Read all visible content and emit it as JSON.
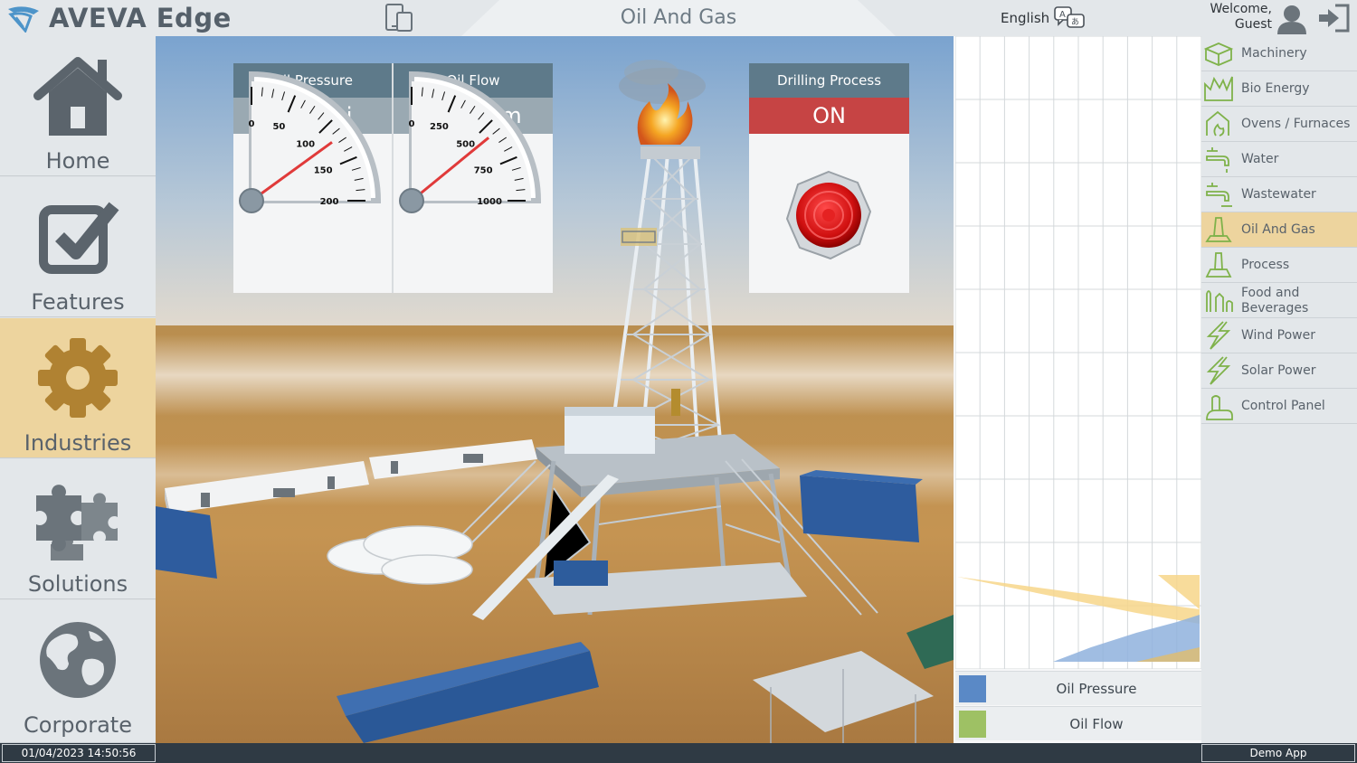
{
  "header": {
    "brand": "AVEVA Edge",
    "page_title": "Oil And Gas",
    "language": "English",
    "welcome": "Welcome,",
    "user": "Guest"
  },
  "left_nav": {
    "items": [
      {
        "label": "Home",
        "icon": "home-icon"
      },
      {
        "label": "Features",
        "icon": "checkbox-icon"
      },
      {
        "label": "Industries",
        "icon": "gear-icon",
        "active": true
      },
      {
        "label": "Solutions",
        "icon": "puzzle-icon"
      },
      {
        "label": "Corporate",
        "icon": "globe-icon"
      }
    ]
  },
  "gauges": {
    "oil_pressure": {
      "title": "Oil Pressure",
      "value_text": "120 psi",
      "value": 120,
      "ticks": [
        "0",
        "50",
        "100",
        "150",
        "200"
      ],
      "max": 200
    },
    "oil_flow": {
      "title": "Oil Flow",
      "value_text": "563 gpm",
      "value": 563,
      "ticks": [
        "0",
        "250",
        "500",
        "750",
        "1000"
      ],
      "max": 1000
    }
  },
  "drilling": {
    "title": "Drilling Process",
    "status": "ON"
  },
  "chart_legend": [
    {
      "label": "Oil Pressure",
      "color": "#5a89c6"
    },
    {
      "label": "Oil Flow",
      "color": "#9ec164"
    }
  ],
  "right_nav": {
    "items": [
      {
        "label": "Machinery",
        "icon": "machinery-icon"
      },
      {
        "label": "Bio Energy",
        "icon": "bio-energy-icon"
      },
      {
        "label": "Ovens / Furnaces",
        "icon": "furnace-icon"
      },
      {
        "label": "Water",
        "icon": "faucet-icon"
      },
      {
        "label": "Wastewater",
        "icon": "wastewater-icon"
      },
      {
        "label": "Oil And Gas",
        "icon": "oil-rig-icon",
        "active": true
      },
      {
        "label": "Process",
        "icon": "process-icon"
      },
      {
        "label": "Food and Beverages",
        "icon": "food-icon"
      },
      {
        "label": "Wind Power",
        "icon": "wind-power-icon"
      },
      {
        "label": "Solar Power",
        "icon": "solar-power-icon"
      },
      {
        "label": "Control Panel",
        "icon": "control-panel-icon"
      }
    ]
  },
  "footer": {
    "datetime": "01/04/2023 14:50:56",
    "app": "Demo App"
  },
  "colors": {
    "accent": "#edd49e",
    "header_panel": "#5e7a8a",
    "status_on": "#c64444",
    "needle": "#e03a3a"
  }
}
